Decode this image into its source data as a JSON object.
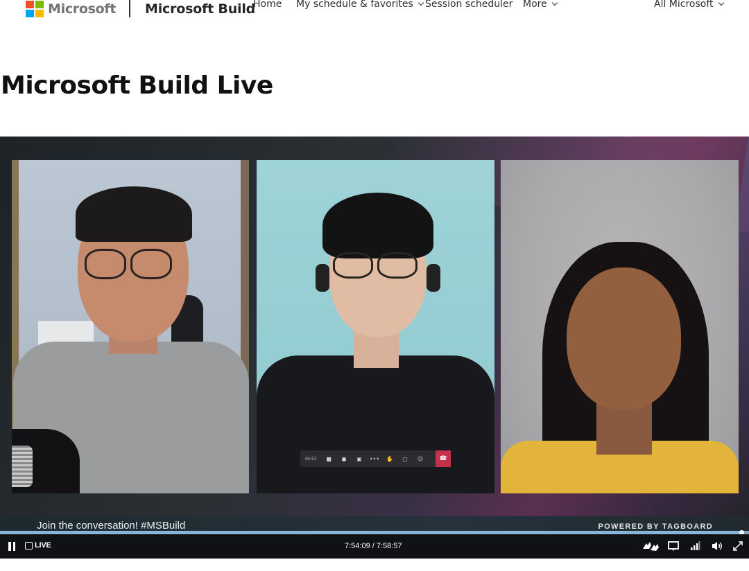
{
  "brand": {
    "wordmark": "Microsoft",
    "logo_colors": [
      "#f25022",
      "#7fba00",
      "#00a4ef",
      "#ffb900"
    ]
  },
  "header": {
    "site_title": "Microsoft Build",
    "nav": [
      {
        "label": "Home",
        "has_dropdown": false
      },
      {
        "label": "My schedule & favorites",
        "has_dropdown": true
      },
      {
        "label": "Session scheduler",
        "has_dropdown": false
      },
      {
        "label": "More",
        "has_dropdown": true
      }
    ],
    "all_microsoft": "All Microsoft"
  },
  "page": {
    "title": "Microsoft Build Live"
  },
  "video": {
    "overlay_hashtag": "Join the conversation! #MSBuild",
    "overlay_powered_by": "POWERED BY TAGBOARD",
    "teams_timer": "49:52",
    "participants": 3
  },
  "player": {
    "live_label": "LIVE",
    "timecode": "7:54:09 / 7:58:57",
    "progress_fraction": 0.99,
    "icons": [
      "pause-icon",
      "sign-language-icon",
      "captions-icon",
      "quality-icon",
      "volume-icon",
      "fullscreen-icon"
    ]
  }
}
